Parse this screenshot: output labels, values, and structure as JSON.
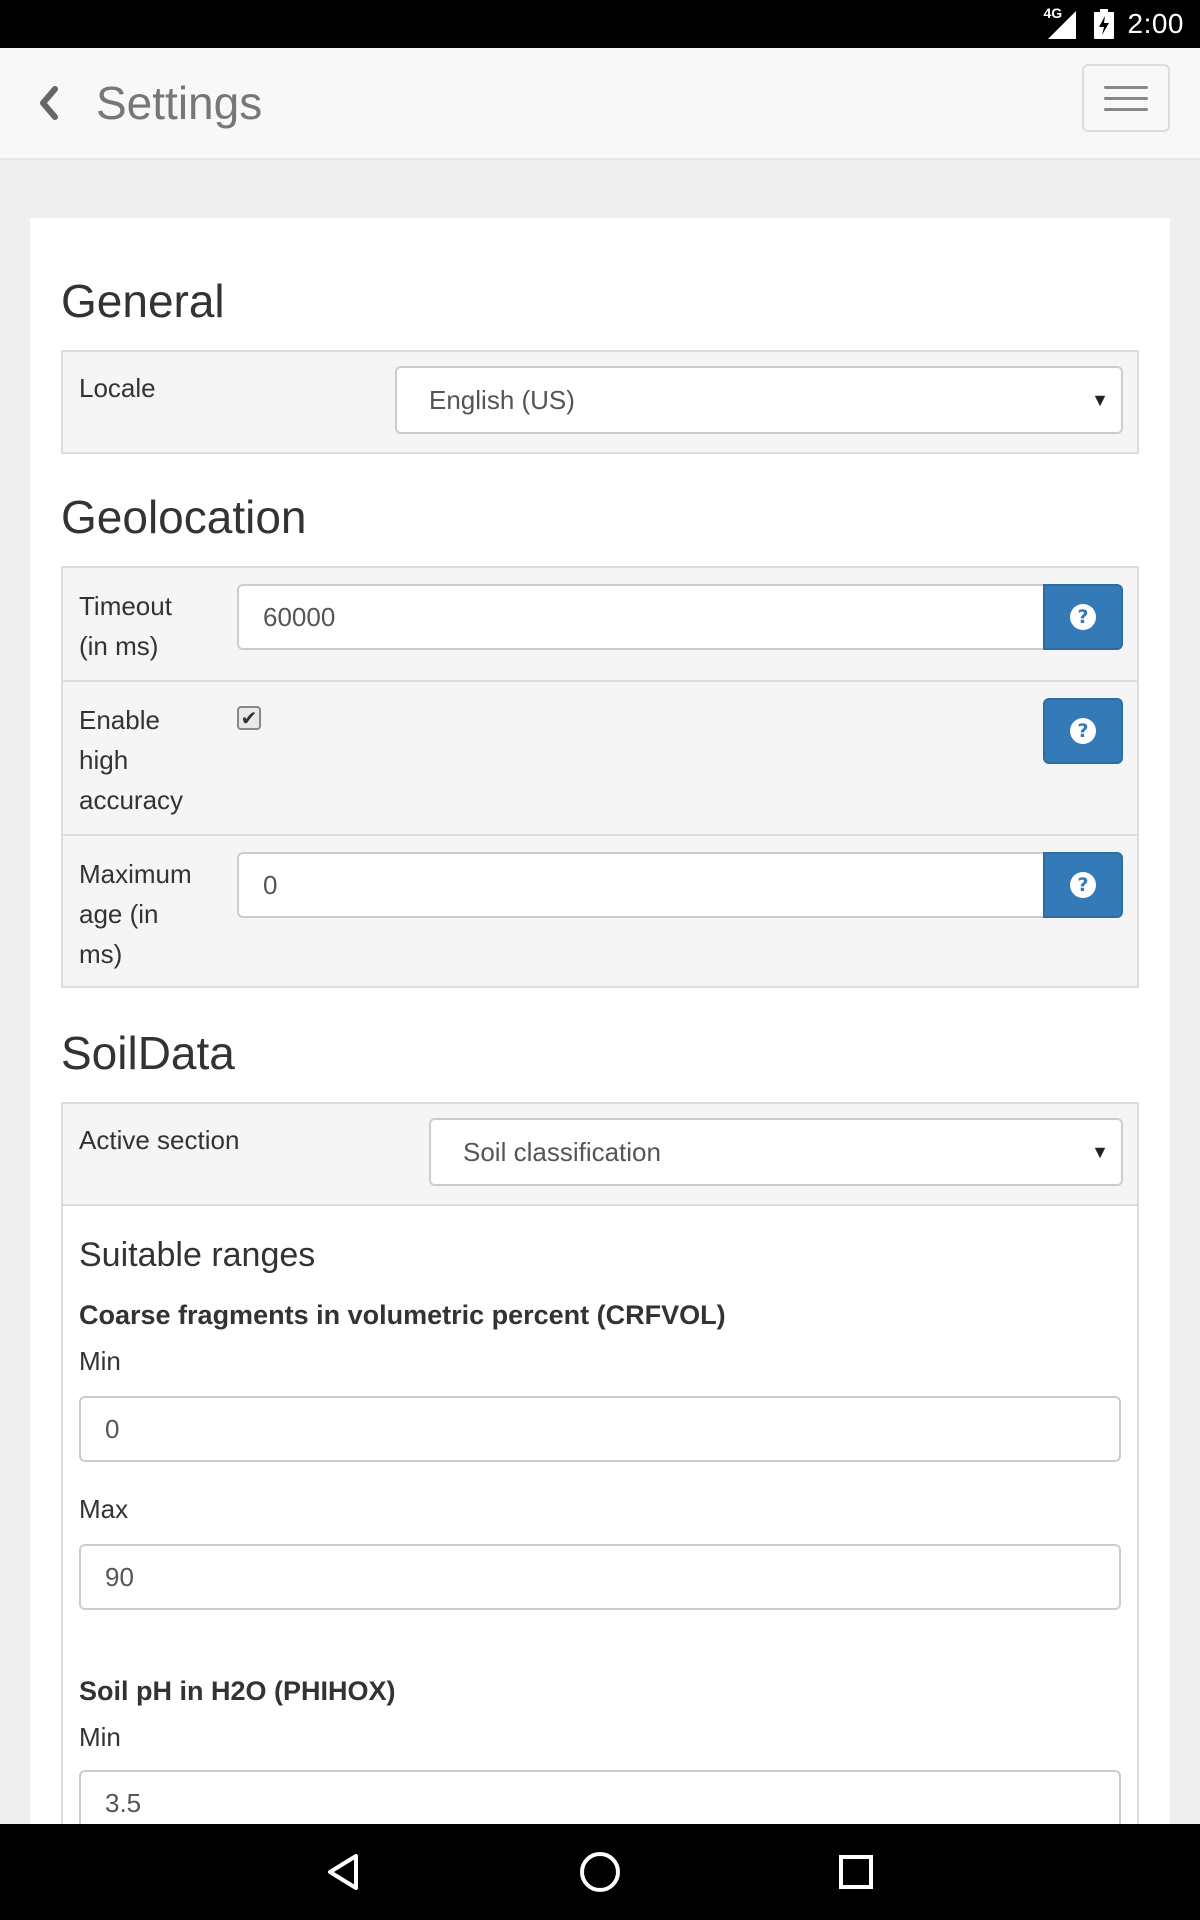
{
  "status_bar": {
    "network": "4G",
    "time": "2:00"
  },
  "header": {
    "title": "Settings",
    "icons": {
      "back": "chevron-left-icon",
      "menu": "hamburger-menu-icon"
    }
  },
  "general": {
    "title": "General",
    "locale": {
      "label": "Locale",
      "value": "English (US)"
    }
  },
  "geolocation": {
    "title": "Geolocation",
    "timeout": {
      "label_line1": "Timeout",
      "label_line2": "(in ms)",
      "value": "60000"
    },
    "high_accuracy": {
      "label_line1": "Enable",
      "label_line2": "high",
      "label_line3": "accuracy",
      "checked": true
    },
    "max_age": {
      "label_line1": "Maximum",
      "label_line2": "age (in",
      "label_line3": "ms)",
      "value": "0"
    },
    "help_icon": "question-circle-icon"
  },
  "soildata": {
    "title": "SoilData",
    "active_section": {
      "label": "Active section",
      "value": "Soil classification"
    },
    "suitable_ranges": {
      "title": "Suitable ranges",
      "crfvol": {
        "title": "Coarse fragments in volumetric percent  (CRFVOL)",
        "min_label": "Min",
        "min_value": "0",
        "max_label": "Max",
        "max_value": "90"
      },
      "phihox": {
        "title": "Soil pH in H2O  (PHIHOX)",
        "min_label": "Min",
        "min_value": "3.5"
      }
    }
  },
  "colors": {
    "accent": "#337ab7",
    "panel_bg": "#f5f5f5",
    "page_bg": "#efefef"
  }
}
